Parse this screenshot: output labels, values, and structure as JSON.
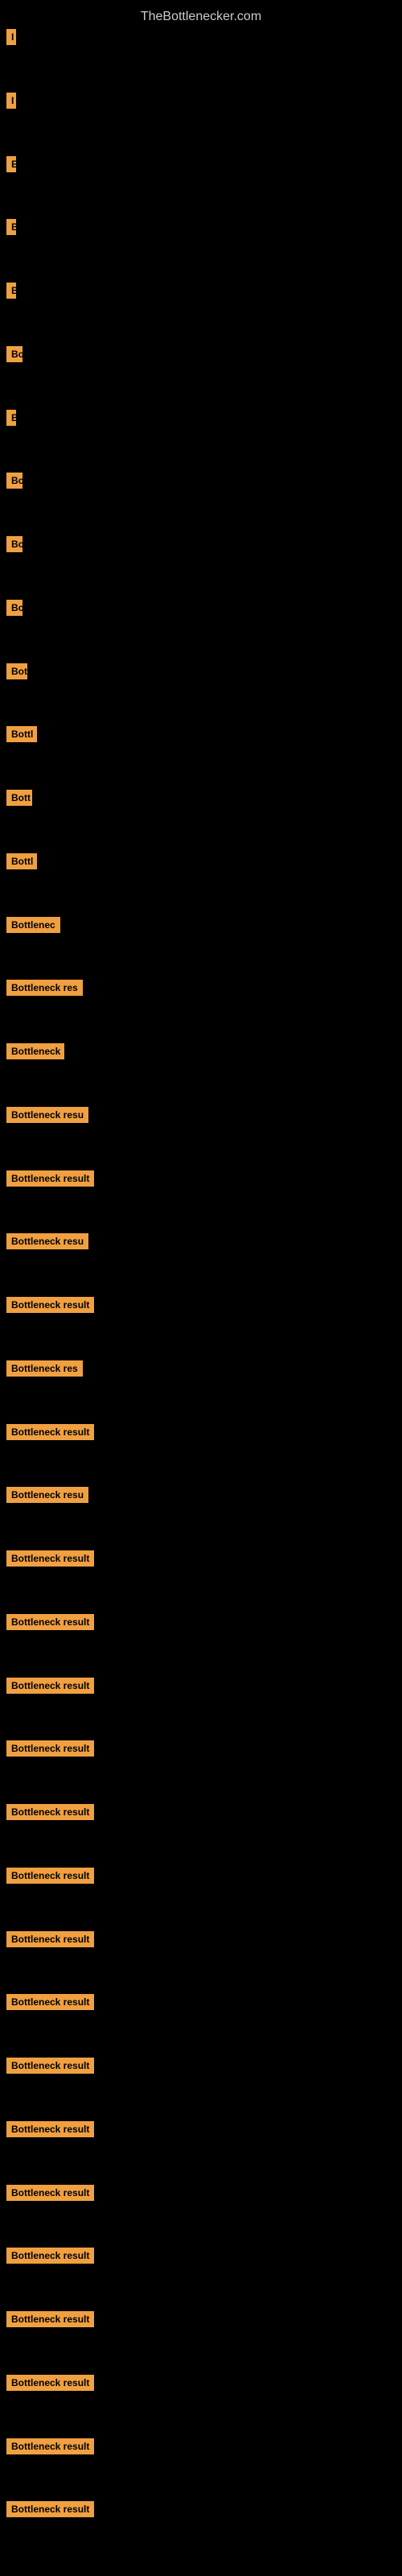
{
  "site": {
    "title": "TheBottlenecker.com"
  },
  "items": [
    {
      "id": 1,
      "label": "I",
      "width": 12
    },
    {
      "id": 2,
      "label": "I",
      "width": 12
    },
    {
      "id": 3,
      "label": "E",
      "width": 12
    },
    {
      "id": 4,
      "label": "B",
      "width": 12
    },
    {
      "id": 5,
      "label": "B",
      "width": 12
    },
    {
      "id": 6,
      "label": "Bo",
      "width": 20
    },
    {
      "id": 7,
      "label": "B",
      "width": 12
    },
    {
      "id": 8,
      "label": "Bo",
      "width": 20
    },
    {
      "id": 9,
      "label": "Bo",
      "width": 20
    },
    {
      "id": 10,
      "label": "Bo",
      "width": 20
    },
    {
      "id": 11,
      "label": "Bot",
      "width": 26
    },
    {
      "id": 12,
      "label": "Bottl",
      "width": 38
    },
    {
      "id": 13,
      "label": "Bott",
      "width": 32
    },
    {
      "id": 14,
      "label": "Bottl",
      "width": 38
    },
    {
      "id": 15,
      "label": "Bottlenec",
      "width": 68
    },
    {
      "id": 16,
      "label": "Bottleneck res",
      "width": 100
    },
    {
      "id": 17,
      "label": "Bottleneck",
      "width": 72
    },
    {
      "id": 18,
      "label": "Bottleneck resu",
      "width": 108
    },
    {
      "id": 19,
      "label": "Bottleneck result",
      "width": 120
    },
    {
      "id": 20,
      "label": "Bottleneck resu",
      "width": 108
    },
    {
      "id": 21,
      "label": "Bottleneck result",
      "width": 120
    },
    {
      "id": 22,
      "label": "Bottleneck res",
      "width": 100
    },
    {
      "id": 23,
      "label": "Bottleneck result",
      "width": 120
    },
    {
      "id": 24,
      "label": "Bottleneck resu",
      "width": 108
    },
    {
      "id": 25,
      "label": "Bottleneck result",
      "width": 120
    },
    {
      "id": 26,
      "label": "Bottleneck result",
      "width": 130
    },
    {
      "id": 27,
      "label": "Bottleneck result",
      "width": 130
    },
    {
      "id": 28,
      "label": "Bottleneck result",
      "width": 140
    },
    {
      "id": 29,
      "label": "Bottleneck result",
      "width": 140
    },
    {
      "id": 30,
      "label": "Bottleneck result",
      "width": 150
    },
    {
      "id": 31,
      "label": "Bottleneck result",
      "width": 150
    },
    {
      "id": 32,
      "label": "Bottleneck result",
      "width": 155
    },
    {
      "id": 33,
      "label": "Bottleneck result",
      "width": 155
    },
    {
      "id": 34,
      "label": "Bottleneck result",
      "width": 160
    },
    {
      "id": 35,
      "label": "Bottleneck result",
      "width": 160
    },
    {
      "id": 36,
      "label": "Bottleneck result",
      "width": 165
    },
    {
      "id": 37,
      "label": "Bottleneck result",
      "width": 165
    },
    {
      "id": 38,
      "label": "Bottleneck result",
      "width": 165
    },
    {
      "id": 39,
      "label": "Bottleneck result",
      "width": 165
    },
    {
      "id": 40,
      "label": "Bottleneck result",
      "width": 165
    }
  ]
}
